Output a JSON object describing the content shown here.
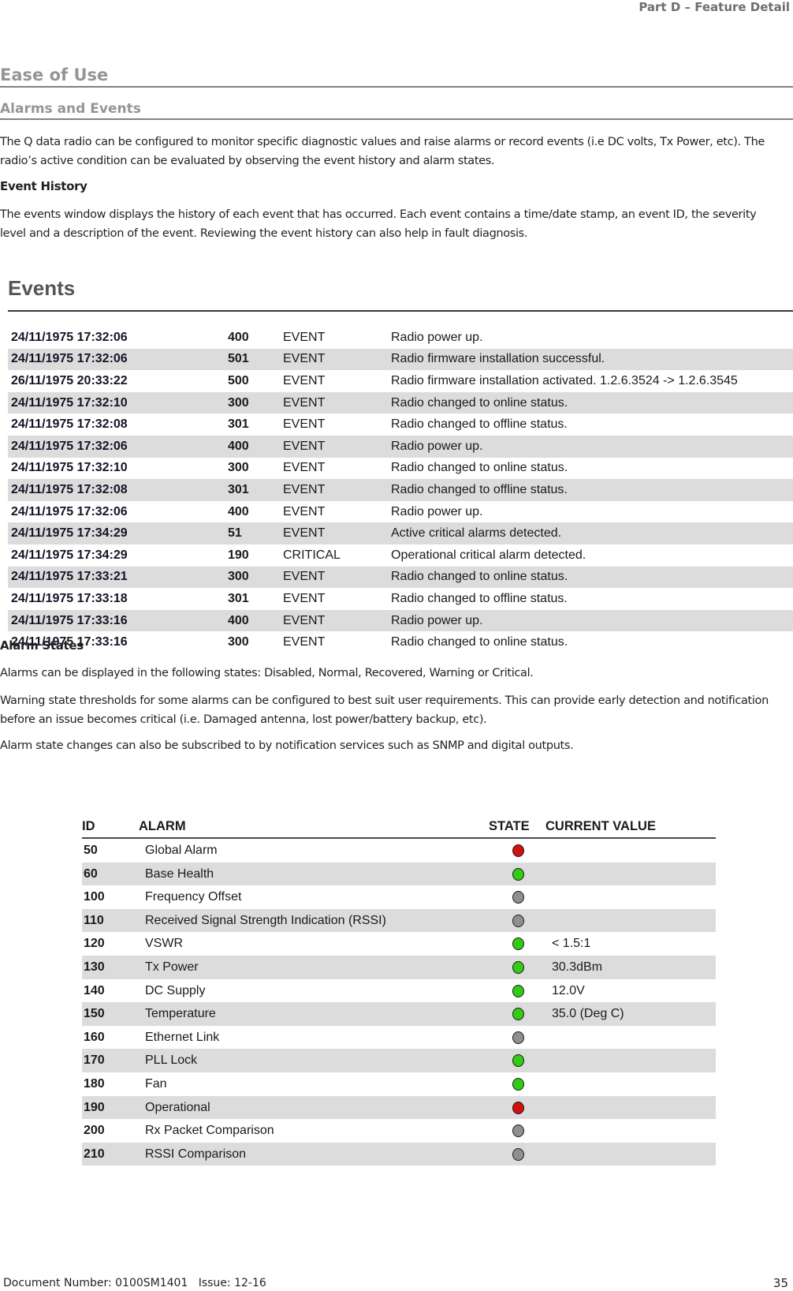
{
  "header": {
    "part_label": "Part D – Feature Detail"
  },
  "section": {
    "title": "Ease of Use",
    "subtitle": "Alarms and Events",
    "intro": "The Q data radio can be configured to monitor specific diagnostic values and raise alarms or record events (i.e DC volts, Tx Power, etc). The radio’s active condition can be evaluated by observing the event history and alarm states."
  },
  "event_history": {
    "heading": "Event History",
    "text": "The events window displays the history of each event that has occurred. Each event contains a time/date stamp, an event ID, the severity level and a description of the event. Reviewing the event history can also help in fault diagnosis.",
    "panel_title": "Events",
    "rows": [
      {
        "date": "24/11/1975 17:32:06",
        "id": "400",
        "severity": "EVENT",
        "description": "Radio power up."
      },
      {
        "date": "24/11/1975 17:32:06",
        "id": "501",
        "severity": "EVENT",
        "description": "Radio firmware installation successful."
      },
      {
        "date": "26/11/1975 20:33:22",
        "id": "500",
        "severity": "EVENT",
        "description": "Radio firmware installation activated. 1.2.6.3524 -> 1.2.6.3545"
      },
      {
        "date": "24/11/1975 17:32:10",
        "id": "300",
        "severity": "EVENT",
        "description": "Radio changed to online status."
      },
      {
        "date": "24/11/1975 17:32:08",
        "id": "301",
        "severity": "EVENT",
        "description": "Radio changed to offline status."
      },
      {
        "date": "24/11/1975 17:32:06",
        "id": "400",
        "severity": "EVENT",
        "description": "Radio power up."
      },
      {
        "date": "24/11/1975 17:32:10",
        "id": "300",
        "severity": "EVENT",
        "description": "Radio changed to online status."
      },
      {
        "date": "24/11/1975 17:32:08",
        "id": "301",
        "severity": "EVENT",
        "description": "Radio changed to offline status."
      },
      {
        "date": "24/11/1975 17:32:06",
        "id": "400",
        "severity": "EVENT",
        "description": "Radio power up."
      },
      {
        "date": "24/11/1975 17:34:29",
        "id": "51",
        "severity": "EVENT",
        "description": "Active critical alarms detected."
      },
      {
        "date": "24/11/1975 17:34:29",
        "id": "190",
        "severity": "CRITICAL",
        "description": "Operational critical alarm detected."
      },
      {
        "date": "24/11/1975 17:33:21",
        "id": "300",
        "severity": "EVENT",
        "description": "Radio changed to online status."
      },
      {
        "date": "24/11/1975 17:33:18",
        "id": "301",
        "severity": "EVENT",
        "description": "Radio changed to offline status."
      },
      {
        "date": "24/11/1975 17:33:16",
        "id": "400",
        "severity": "EVENT",
        "description": "Radio power up."
      },
      {
        "date": "24/11/1975 17:33:16",
        "id": "300",
        "severity": "EVENT",
        "description": "Radio changed to online status."
      }
    ]
  },
  "alarm_states": {
    "heading": "Alarm States",
    "paragraphs": [
      "Alarms can be displayed in the following states: Disabled, Normal, Recovered, Warning or Critical.",
      "Warning state thresholds for some alarms can be configured to best suit user requirements. This can provide early detection and notification before an issue becomes critical (i.e. Damaged antenna, lost power/battery backup, etc).",
      "Alarm state changes can also be subscribed to by notification services such as SNMP and digital outputs."
    ],
    "table": {
      "headers": {
        "id": "ID",
        "alarm": "ALARM",
        "state": "STATE",
        "value": "CURRENT VALUE"
      },
      "state_colors": {
        "critical": "#d40f0f",
        "normal": "#33cc14",
        "disabled": "#8f8f8f"
      },
      "rows": [
        {
          "id": "50",
          "name": "Global Alarm",
          "state": "critical",
          "value": ""
        },
        {
          "id": "60",
          "name": "Base Health",
          "state": "normal",
          "value": ""
        },
        {
          "id": "100",
          "name": "Frequency Offset",
          "state": "disabled",
          "value": ""
        },
        {
          "id": "110",
          "name": "Received Signal Strength Indication (RSSI)",
          "state": "disabled",
          "value": ""
        },
        {
          "id": "120",
          "name": "VSWR",
          "state": "normal",
          "value": "< 1.5:1"
        },
        {
          "id": "130",
          "name": "Tx Power",
          "state": "normal",
          "value": "30.3dBm"
        },
        {
          "id": "140",
          "name": "DC Supply",
          "state": "normal",
          "value": "12.0V"
        },
        {
          "id": "150",
          "name": "Temperature",
          "state": "normal",
          "value": "35.0 (Deg C)"
        },
        {
          "id": "160",
          "name": "Ethernet Link",
          "state": "disabled",
          "value": ""
        },
        {
          "id": "170",
          "name": "PLL Lock",
          "state": "normal",
          "value": ""
        },
        {
          "id": "180",
          "name": "Fan",
          "state": "normal",
          "value": ""
        },
        {
          "id": "190",
          "name": "Operational",
          "state": "critical",
          "value": ""
        },
        {
          "id": "200",
          "name": "Rx Packet Comparison",
          "state": "disabled",
          "value": ""
        },
        {
          "id": "210",
          "name": "RSSI Comparison",
          "state": "disabled",
          "value": ""
        }
      ]
    }
  },
  "footer": {
    "document_info": "Document Number: 0100SM1401   Issue: 12-16",
    "page_number": "35"
  }
}
